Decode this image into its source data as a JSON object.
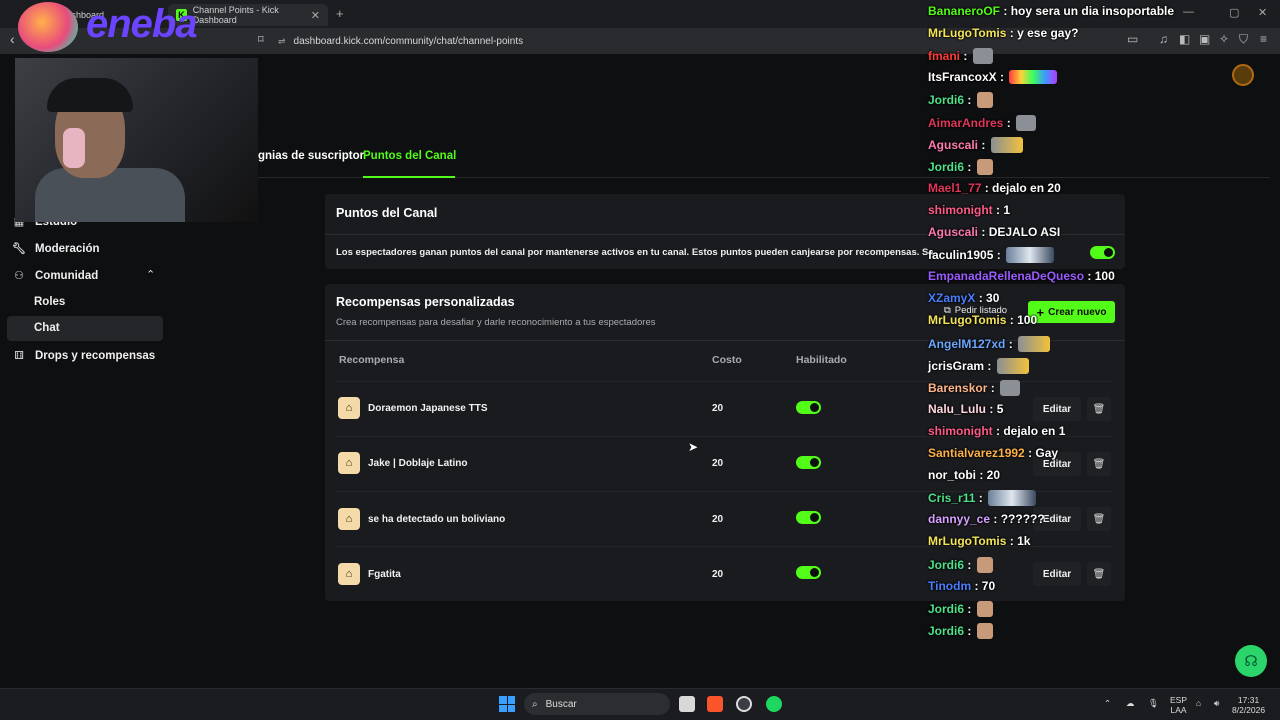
{
  "browser": {
    "tab_inactive": "Dashboard",
    "tab_active": "Channel Points - Kick Dashboard",
    "tab_active_favicon": "K",
    "url": "dashboard.kick.com/community/chat/channel-points"
  },
  "sponsor": {
    "logo_text": "eneba"
  },
  "subnav": {
    "item_partial": "gnias de suscriptor",
    "item_active": "Puntos del Canal"
  },
  "sidebar": {
    "items": [
      {
        "label": "Estudio",
        "icon": "studio-icon"
      },
      {
        "label": "Moderación",
        "icon": "wrench-icon"
      },
      {
        "label": "Comunidad",
        "icon": "community-icon"
      },
      {
        "label": "Roles"
      },
      {
        "label": "Chat"
      },
      {
        "label": "Drops y recompensas",
        "icon": "gift-icon"
      }
    ]
  },
  "channel_points": {
    "title": "Puntos del Canal",
    "description": "Los espectadores ganan puntos del canal por mantenerse activos en tu canal. Estos puntos pueden canjearse por recompensas. Sa",
    "enabled": true
  },
  "rewards": {
    "title": "Recompensas personalizadas",
    "subtitle": "Crea recompensas para desafiar y darle reconocimiento a tus espectadores",
    "pedir_label": "Pedir listado",
    "crear_label": "Crear nuevo",
    "headers": {
      "name": "Recompensa",
      "cost": "Costo",
      "enabled": "Habilitado"
    },
    "edit_label": "Editar",
    "rows": [
      {
        "name": "Doraemon Japanese TTS",
        "cost": "20",
        "enabled": true
      },
      {
        "name": "Jake | Doblaje Latino",
        "cost": "20",
        "enabled": true
      },
      {
        "name": "se ha detectado un boliviano",
        "cost": "20",
        "enabled": true
      },
      {
        "name": "Fgatita",
        "cost": "20",
        "enabled": true
      }
    ]
  },
  "chat": [
    {
      "user": "BananeroOF",
      "color": "#53fc18",
      "msg": "hoy sera un dia insoportable"
    },
    {
      "user": "MrLugoTomis",
      "color": "#f3e45a",
      "msg": "y ese gay?"
    },
    {
      "user": "fmani",
      "color": "#ff3b3b",
      "msg": "",
      "emote": "sq"
    },
    {
      "user": "ItsFrancoxX",
      "color": "#ffffff",
      "msg": "",
      "emote": "rb"
    },
    {
      "user": "Jordi6",
      "color": "#4fe08a",
      "msg": "",
      "emote": "face"
    },
    {
      "user": "AimarAndres",
      "color": "#e0365a",
      "msg": "",
      "emote": "sq"
    },
    {
      "user": "Aguscali",
      "color": "#ff7ab0",
      "msg": "",
      "emote": "cat"
    },
    {
      "user": "Jordi6",
      "color": "#4fe08a",
      "msg": "",
      "emote": "face"
    },
    {
      "user": "Mael1_77",
      "color": "#e0365a",
      "msg": "dejalo en 20"
    },
    {
      "user": "shimonight",
      "color": "#ff5a8a",
      "msg": "1"
    },
    {
      "user": "Aguscali",
      "color": "#ff7ab0",
      "msg": "DEJALO ASI"
    },
    {
      "user": "faculin1905",
      "color": "#ffffff",
      "msg": "",
      "emote": "wide"
    },
    {
      "user": "EmpanadaRellenaDeQueso",
      "color": "#9b5cff",
      "msg": "100"
    },
    {
      "user": "XZamyX",
      "color": "#4a7dff",
      "msg": "30"
    },
    {
      "user": "MrLugoTomis",
      "color": "#f3e45a",
      "msg": "100"
    },
    {
      "user": "AngelM127xd",
      "color": "#6aa8ff",
      "msg": "",
      "emote": "cat"
    },
    {
      "user": "jcrisGram",
      "color": "#ffffff",
      "msg": "",
      "emote": "cat"
    },
    {
      "user": "Barenskor",
      "color": "#ffb48a",
      "msg": "",
      "emote": "sq"
    },
    {
      "user": "Nalu_Lulu",
      "color": "#ffd6e0",
      "msg": "5"
    },
    {
      "user": "shimonight",
      "color": "#ff5a8a",
      "msg": "dejalo en 1"
    },
    {
      "user": "Santialvarez1992",
      "color": "#ffb14a",
      "msg": "Gay"
    },
    {
      "user": "nor_tobi",
      "color": "#ffffff",
      "msg": "20"
    },
    {
      "user": "Cris_r11",
      "color": "#4fe08a",
      "msg": "",
      "emote": "wide"
    },
    {
      "user": "dannyy_ce",
      "color": "#d7a0ff",
      "msg": "??????"
    },
    {
      "user": "MrLugoTomis",
      "color": "#f3e45a",
      "msg": "1k"
    },
    {
      "user": "Jordi6",
      "color": "#4fe08a",
      "msg": "",
      "emote": "face"
    },
    {
      "user": "Tinodm",
      "color": "#4a7dff",
      "msg": "70"
    },
    {
      "user": "Jordi6",
      "color": "#4fe08a",
      "msg": "",
      "emote": "face"
    },
    {
      "user": "Jordi6",
      "color": "#4fe08a",
      "msg": "",
      "emote": "face"
    }
  ],
  "taskbar": {
    "search_label": "Buscar",
    "lang_top": "ESP",
    "lang_bottom": "LAA",
    "time": "17:31",
    "date": "8/2/2026"
  },
  "colors": {
    "accent": "#53fc18"
  }
}
